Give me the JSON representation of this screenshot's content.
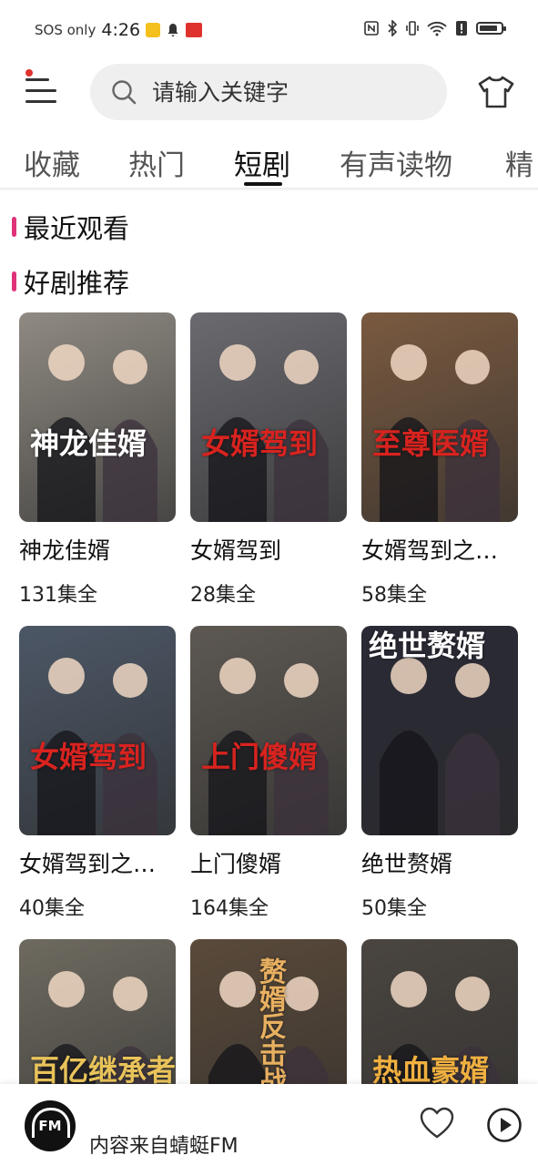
{
  "status_bar": {
    "carrier": "SOS only",
    "time": "4:26",
    "battery_level": 0.85
  },
  "header": {
    "search_placeholder": "请输入关键字"
  },
  "tabs": [
    {
      "label": "收藏"
    },
    {
      "label": "热门"
    },
    {
      "label": "短剧",
      "active": true
    },
    {
      "label": "有声读物"
    },
    {
      "label": "精"
    }
  ],
  "sections": {
    "recent": "最近观看",
    "recommend": "好剧推荐"
  },
  "dramas": [
    {
      "name": "神龙佳婿",
      "episodes": "131集全",
      "poster_text": "神龙佳婿",
      "poster_bg": "#8f8a82",
      "accent": "#ffffff"
    },
    {
      "name": "女婿驾到",
      "episodes": "28集全",
      "poster_text": "女婿驾到",
      "poster_bg": "#6b6a70",
      "accent": "#d8231f"
    },
    {
      "name": "女婿驾到之至尊医婿",
      "episodes": "58集全",
      "poster_text": "至尊医婿",
      "poster_bg": "#7a5a40",
      "accent": "#d8231f"
    },
    {
      "name": "女婿驾到之王者归来",
      "episodes": "40集全",
      "poster_text": "女婿驾到",
      "poster_bg": "#4c5766",
      "accent": "#d8231f"
    },
    {
      "name": "上门傻婿",
      "episodes": "164集全",
      "poster_text": "上门傻婿",
      "poster_bg": "#5d5852",
      "accent": "#d8231f"
    },
    {
      "name": "绝世赘婿",
      "episodes": "50集全",
      "poster_text": "绝世赘婿",
      "poster_bg": "#2a2a36",
      "accent": "#ffffff"
    },
    {
      "name": "",
      "episodes": "",
      "poster_text": "百亿继承者",
      "poster_bg": "#6e6a60",
      "accent": "#e9c35a"
    },
    {
      "name": "",
      "episodes": "",
      "poster_text": "赘婿反击战",
      "poster_bg": "#5a4a3a",
      "accent": "#e8b060"
    },
    {
      "name": "",
      "episodes": "",
      "poster_text": "热血豪婿",
      "poster_bg": "#4a4540",
      "accent": "#f0b040"
    }
  ],
  "player": {
    "logo_text": "FM",
    "source_text": "内容来自蜻蜓FM"
  },
  "colors": {
    "section_bar": "#e0327a",
    "notification_dot": "#e0322d"
  }
}
